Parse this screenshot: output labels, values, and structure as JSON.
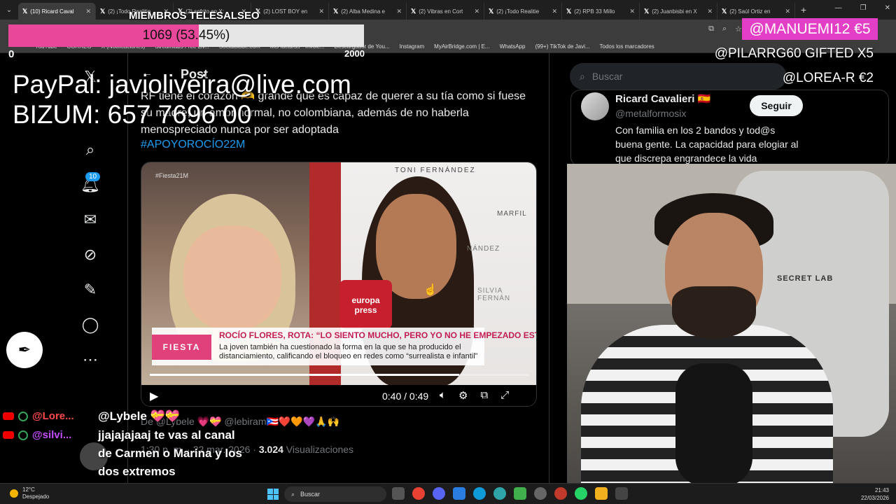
{
  "browser": {
    "tabs": [
      {
        "label": "(10) Ricard Caval",
        "active": true
      },
      {
        "label": "(2) ¡Todo Realitie"
      },
      {
        "label": "(2) sofrito en X:"
      },
      {
        "label": "(2) LOST BOY en"
      },
      {
        "label": "(2) Alba Medina e"
      },
      {
        "label": "(2) Vibras en Cort"
      },
      {
        "label": "(2) ¡Todo Realitie"
      },
      {
        "label": "(2) RPB 33 Millo"
      },
      {
        "label": "(2) Juanbisbi en X"
      },
      {
        "label": "(2) Saúl Ortiz en"
      }
    ],
    "new_tab": "+",
    "bookmarks": [
      "YouTube",
      "CORREO",
      "X (Notificaciones)",
      "Streamlabs Free Liv...",
      "Socialblade.com",
      "Mis facturas - Invoic...",
      "Descargador de You...",
      "Instagram",
      "MyAirBridge.com | E...",
      "WhatsApp",
      "(99+) TikTok de Javi...",
      "Todos los marcadores"
    ]
  },
  "overlay": {
    "members_title": "MIEMBROS TELESALSEO",
    "goal_text": "1069 (53.45%)",
    "goal_fraction": 0.5345,
    "goal_min": "0",
    "goal_max": "2000",
    "paypal": "PayPal: javioliveira@live.com",
    "bizum": "BIZUM: 657 7696 00",
    "top_donor": "@MANUEMI12  €5",
    "donors": [
      "@PILARRG60  GIFTED X5",
      "@LOREA-R  €2"
    ],
    "accent_color": "#e33fc6"
  },
  "x": {
    "header": "Post",
    "tweet_text": "RF tiene el corazón 🫶 grande que es capaz de querer a su tía como si fuese su madre, un amor normal, no colombiana, además de no haberla menospreciado nunca por ser adoptada",
    "hashtag": "#APOYOROCÍO22M",
    "notif_count": "10",
    "video": {
      "tag": "#Fiesta21M",
      "brand": "TONI FERNÁNDEZ",
      "brand2": "MARFIL",
      "brand3": "NÁNDEZ",
      "brand4": "SILVIA FERNÁN",
      "mic_label": "europa press",
      "badge": "FIESTA",
      "headline": "ROCÍO FLORES, ROTA: “LO SIENTO MUCHO, PERO YO NO HE EMPEZADO ESTO”",
      "subline": "La joven también ha cuestionado la forma en la que se ha producido el distanciamiento, calificando el bloqueo en redes como “surrealista e infantil”",
      "time": "0:40 / 0:49",
      "progress": 0.816
    },
    "reply_line": "De @Lybele 💗💝 @lebiram🇵🇷❤️🧡💜🙏🙌",
    "meta_time": "1:30 p. m. · 22 mar. 2026 · ",
    "meta_views_count": "3.024",
    "meta_views_label": " Visualizaciones",
    "search_placeholder": "Buscar",
    "rec": {
      "name": "Ricard Cavalieri 🇪🇸",
      "handle": "@metalformosix",
      "follow": "Seguir",
      "bio": "Con familia en los 2 bandos y tod@s buena gente. La capacidad para elogiar al que discrepa engrandece la vida"
    }
  },
  "webcam": {
    "chair_logo": "SECRET LAB"
  },
  "chat": [
    {
      "user": "@Lore...",
      "msg": "@Lybele 💝💝"
    },
    {
      "user": "@silvi...",
      "msg": "jjajajajaaj te vas al canal de Carmen o Marina y los dos extremos"
    }
  ],
  "taskbar": {
    "temp": "12°C",
    "weather": "Despejado",
    "search": "Buscar",
    "time": "21:43",
    "date": "22/03/2026"
  }
}
